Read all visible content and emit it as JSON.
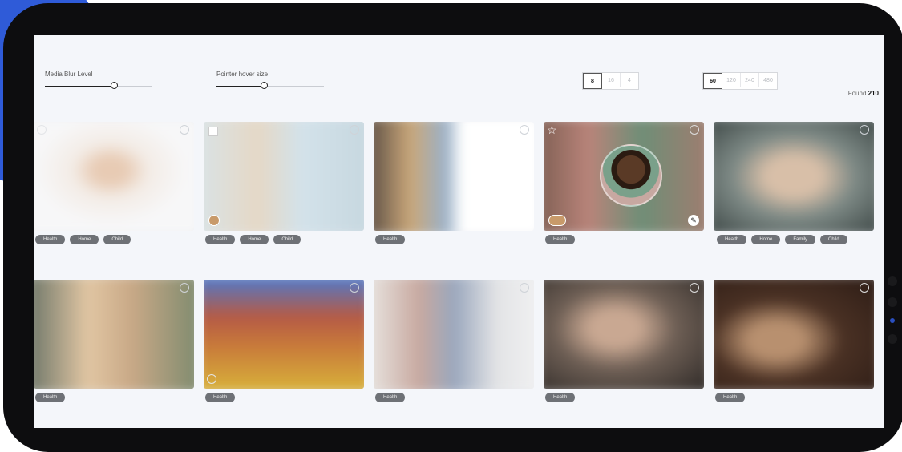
{
  "controls": {
    "blur_label": "Media Blur Level",
    "blur_value": 0.65,
    "pointer_label": "Pointer hover size",
    "pointer_value": 0.45,
    "grid_columns": [
      "8",
      "16",
      "4"
    ],
    "grid_active": "8",
    "page_sizes": [
      "60",
      "120",
      "240",
      "480"
    ],
    "page_active": "60",
    "found_label": "Found",
    "found_count": "210"
  },
  "cards": [
    {
      "tags": [
        "Health",
        "Home",
        "Child"
      ]
    },
    {
      "tags": [
        "Health",
        "Home",
        "Child"
      ]
    },
    {
      "tags": [
        "Health"
      ]
    },
    {
      "tags": [
        "Health"
      ]
    },
    {
      "tags": [
        "Health",
        "Home",
        "Family",
        "Child"
      ]
    },
    {
      "tags": [
        "Health"
      ]
    },
    {
      "tags": [
        "Health"
      ]
    },
    {
      "tags": [
        "Health"
      ]
    },
    {
      "tags": [
        "Health"
      ]
    },
    {
      "tags": [
        "Health"
      ]
    }
  ],
  "icons": {
    "star": "star-icon",
    "edit": "pencil-icon",
    "select": "checkbox-circle-icon"
  },
  "colors": {
    "tag": "#6e7176",
    "device": "#0d0d0f",
    "accent": "#2f5bd8"
  }
}
